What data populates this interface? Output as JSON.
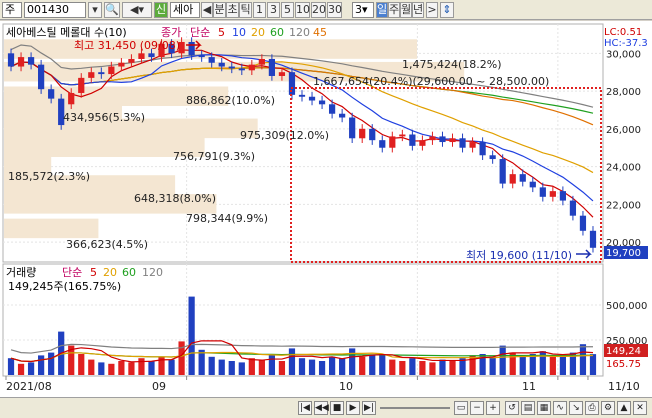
{
  "toolbar": {
    "market": "주",
    "code": "001430",
    "name_short": "세아",
    "period_buttons": [
      "분",
      "초",
      "틱",
      "1",
      "3",
      "5",
      "10",
      "20",
      "30"
    ],
    "interval_value": "3",
    "range_buttons": [
      "일",
      "주",
      "월",
      "년"
    ]
  },
  "price_panel": {
    "legend_name": "세아베스틸 메롤대 수(10)",
    "legend_close": "종가",
    "legend_ma": "단순",
    "ma_periods": [
      "5",
      "10",
      "20",
      "60",
      "120",
      "45"
    ],
    "top_right_lc": "LC:0.51",
    "top_right_hc": "HC:-37.3",
    "high_label": "최고 31,450 (09/08)",
    "low_label": "최저 19,600 (11/10)",
    "current_price": "19,700",
    "volume_profile_labels": [
      "1,475,424(18.2%)",
      "1,667,654(20.4%)(29,600.00 ~ 28,500.00)",
      "886,862(10.0%)",
      "434,956(5.3%)",
      "975,309(12.0%)",
      "756,791(9.3%)",
      "185,572(2.3%)",
      "648,318(8.0%)",
      "798,344(9.9%)",
      "366,623(4.5%)"
    ],
    "y_ticks": [
      "30,000",
      "28,000",
      "26,000",
      "24,000",
      "22,000",
      "20,000"
    ]
  },
  "volume_panel": {
    "legend_name": "거래량",
    "legend_ma": "단순",
    "ma_periods": [
      "5",
      "20",
      "60",
      "120"
    ],
    "value_label": "149,245주(165.75%)",
    "y_ticks": [
      "500,000",
      "250,000"
    ],
    "current_volume": "149,24",
    "current_ratio": "165.75"
  },
  "x_axis": [
    "2021/08",
    "09",
    "10",
    "11",
    "11/10"
  ],
  "chart_data": {
    "type": "candlestick",
    "x": [
      "08/12",
      "08/13",
      "08/17",
      "08/18",
      "08/19",
      "08/20",
      "08/23",
      "08/24",
      "08/25",
      "08/26",
      "08/27",
      "08/30",
      "08/31",
      "09/01",
      "09/02",
      "09/03",
      "09/06",
      "09/07",
      "09/08",
      "09/09",
      "09/10",
      "09/13",
      "09/14",
      "09/15",
      "09/16",
      "09/17",
      "09/23",
      "09/24",
      "09/27",
      "09/28",
      "09/29",
      "09/30",
      "10/01",
      "10/05",
      "10/06",
      "10/07",
      "10/08",
      "10/12",
      "10/13",
      "10/14",
      "10/15",
      "10/18",
      "10/19",
      "10/20",
      "10/21",
      "10/22",
      "10/25",
      "10/26",
      "10/27",
      "10/28",
      "10/29",
      "11/01",
      "11/02",
      "11/03",
      "11/04",
      "11/05",
      "11/08",
      "11/09",
      "11/10"
    ],
    "open": [
      30000,
      29300,
      29800,
      29400,
      28100,
      27600,
      27300,
      27900,
      28700,
      29000,
      28900,
      29300,
      29500,
      29700,
      30000,
      29800,
      30500,
      30000,
      30600,
      29900,
      29800,
      29500,
      29300,
      29200,
      29100,
      29400,
      29700,
      28800,
      29000,
      27800,
      27700,
      27500,
      27300,
      26800,
      26600,
      25500,
      26000,
      25400,
      25000,
      25600,
      25700,
      25100,
      25400,
      25600,
      25300,
      25500,
      25000,
      25300,
      24600,
      24400,
      23100,
      23600,
      23200,
      22900,
      22400,
      22700,
      22200,
      21400,
      20600
    ],
    "close": [
      29300,
      29800,
      29400,
      28100,
      27600,
      26200,
      27900,
      28700,
      29000,
      28900,
      29300,
      29500,
      29700,
      30000,
      29800,
      30500,
      30000,
      30600,
      29900,
      29800,
      29500,
      29300,
      29200,
      29100,
      29400,
      29700,
      28800,
      29000,
      27800,
      27700,
      27500,
      27300,
      26800,
      26600,
      25500,
      26000,
      25400,
      25000,
      25600,
      25700,
      25100,
      25400,
      25600,
      25300,
      25500,
      25000,
      25300,
      24600,
      24400,
      23100,
      23600,
      23200,
      22900,
      22400,
      22700,
      22200,
      21400,
      20600,
      19700
    ],
    "volume": [
      120000,
      80000,
      90000,
      140000,
      160000,
      310000,
      210000,
      150000,
      110000,
      90000,
      80000,
      100000,
      90000,
      120000,
      100000,
      130000,
      110000,
      240000,
      560000,
      180000,
      130000,
      110000,
      100000,
      90000,
      120000,
      110000,
      150000,
      100000,
      190000,
      120000,
      110000,
      100000,
      130000,
      120000,
      190000,
      130000,
      140000,
      150000,
      110000,
      100000,
      120000,
      100000,
      90000,
      110000,
      100000,
      120000,
      140000,
      150000,
      130000,
      210000,
      160000,
      140000,
      150000,
      170000,
      130000,
      140000,
      160000,
      220000,
      149245
    ],
    "ylim": [
      19000,
      31500
    ],
    "volume_ylim": [
      0,
      600000
    ]
  }
}
